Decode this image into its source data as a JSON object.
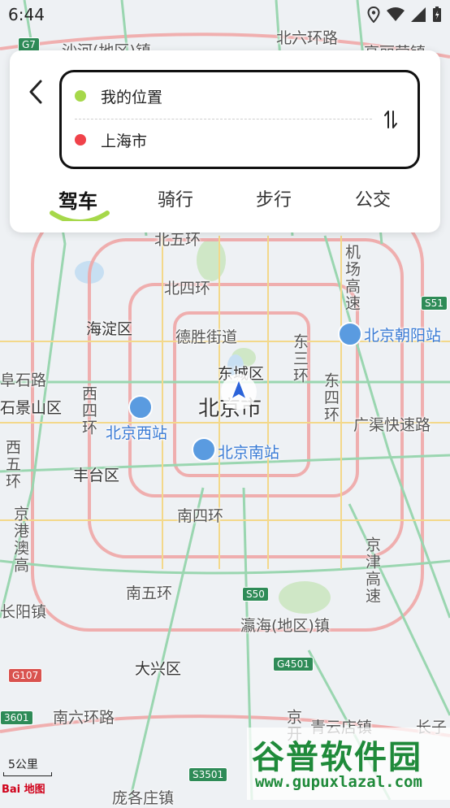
{
  "status_bar": {
    "time": "6:44"
  },
  "route_card": {
    "start": {
      "text": "我的位置",
      "color": "#a6d84a"
    },
    "end": {
      "text": "上海市",
      "color": "#f0424a"
    }
  },
  "tabs": [
    {
      "label": "驾车",
      "active": true
    },
    {
      "label": "骑行",
      "active": false
    },
    {
      "label": "步行",
      "active": false
    },
    {
      "label": "公交",
      "active": false
    }
  ],
  "map": {
    "labels": {
      "shahe": "沙河(地区)镇",
      "beiliu": "北六环路",
      "gaoliying": "高丽营镇",
      "beiwu": "北五环",
      "beisi": "北四环",
      "haidian": "海淀区",
      "deshengjie": "德胜街道",
      "dongcheng": "东城区",
      "beijing": "北京市",
      "fushilu": "阜石路",
      "shijingshan": "石景山区",
      "fengtai": "丰台区",
      "guangqu": "广渠快速路",
      "nansi": "南四环",
      "nanwu": "南五环",
      "yingyang": "长阳镇",
      "yinghai": "瀛海(地区)镇",
      "daxing": "大兴区",
      "nanliu": "南六环路",
      "qingyundian": "青云店镇",
      "changzi": "长子",
      "pangezhuang": "庞各庄镇"
    },
    "vertical_labels": {
      "xisi": "西四环",
      "dongsan": "东三环",
      "dongsi": "东四环",
      "xiwu": "西五环",
      "airport": "机场高速",
      "jinggang": "京港澳高",
      "jingjin": "京津高速",
      "jingkai": "京开"
    },
    "stations": {
      "chaoyang": "北京朝阳站",
      "west": "北京西站",
      "south": "北京南站"
    },
    "shields": {
      "g7": "G7",
      "s51": "S51",
      "s50": "S50",
      "g4501": "G4501",
      "g107": "G107",
      "s3601": "3601",
      "s3501": "S3501"
    },
    "scale": "5公里",
    "logo": "Bai 地图"
  },
  "watermark": {
    "title": "谷普软件园",
    "url": "www.gupuxlazal.com"
  }
}
